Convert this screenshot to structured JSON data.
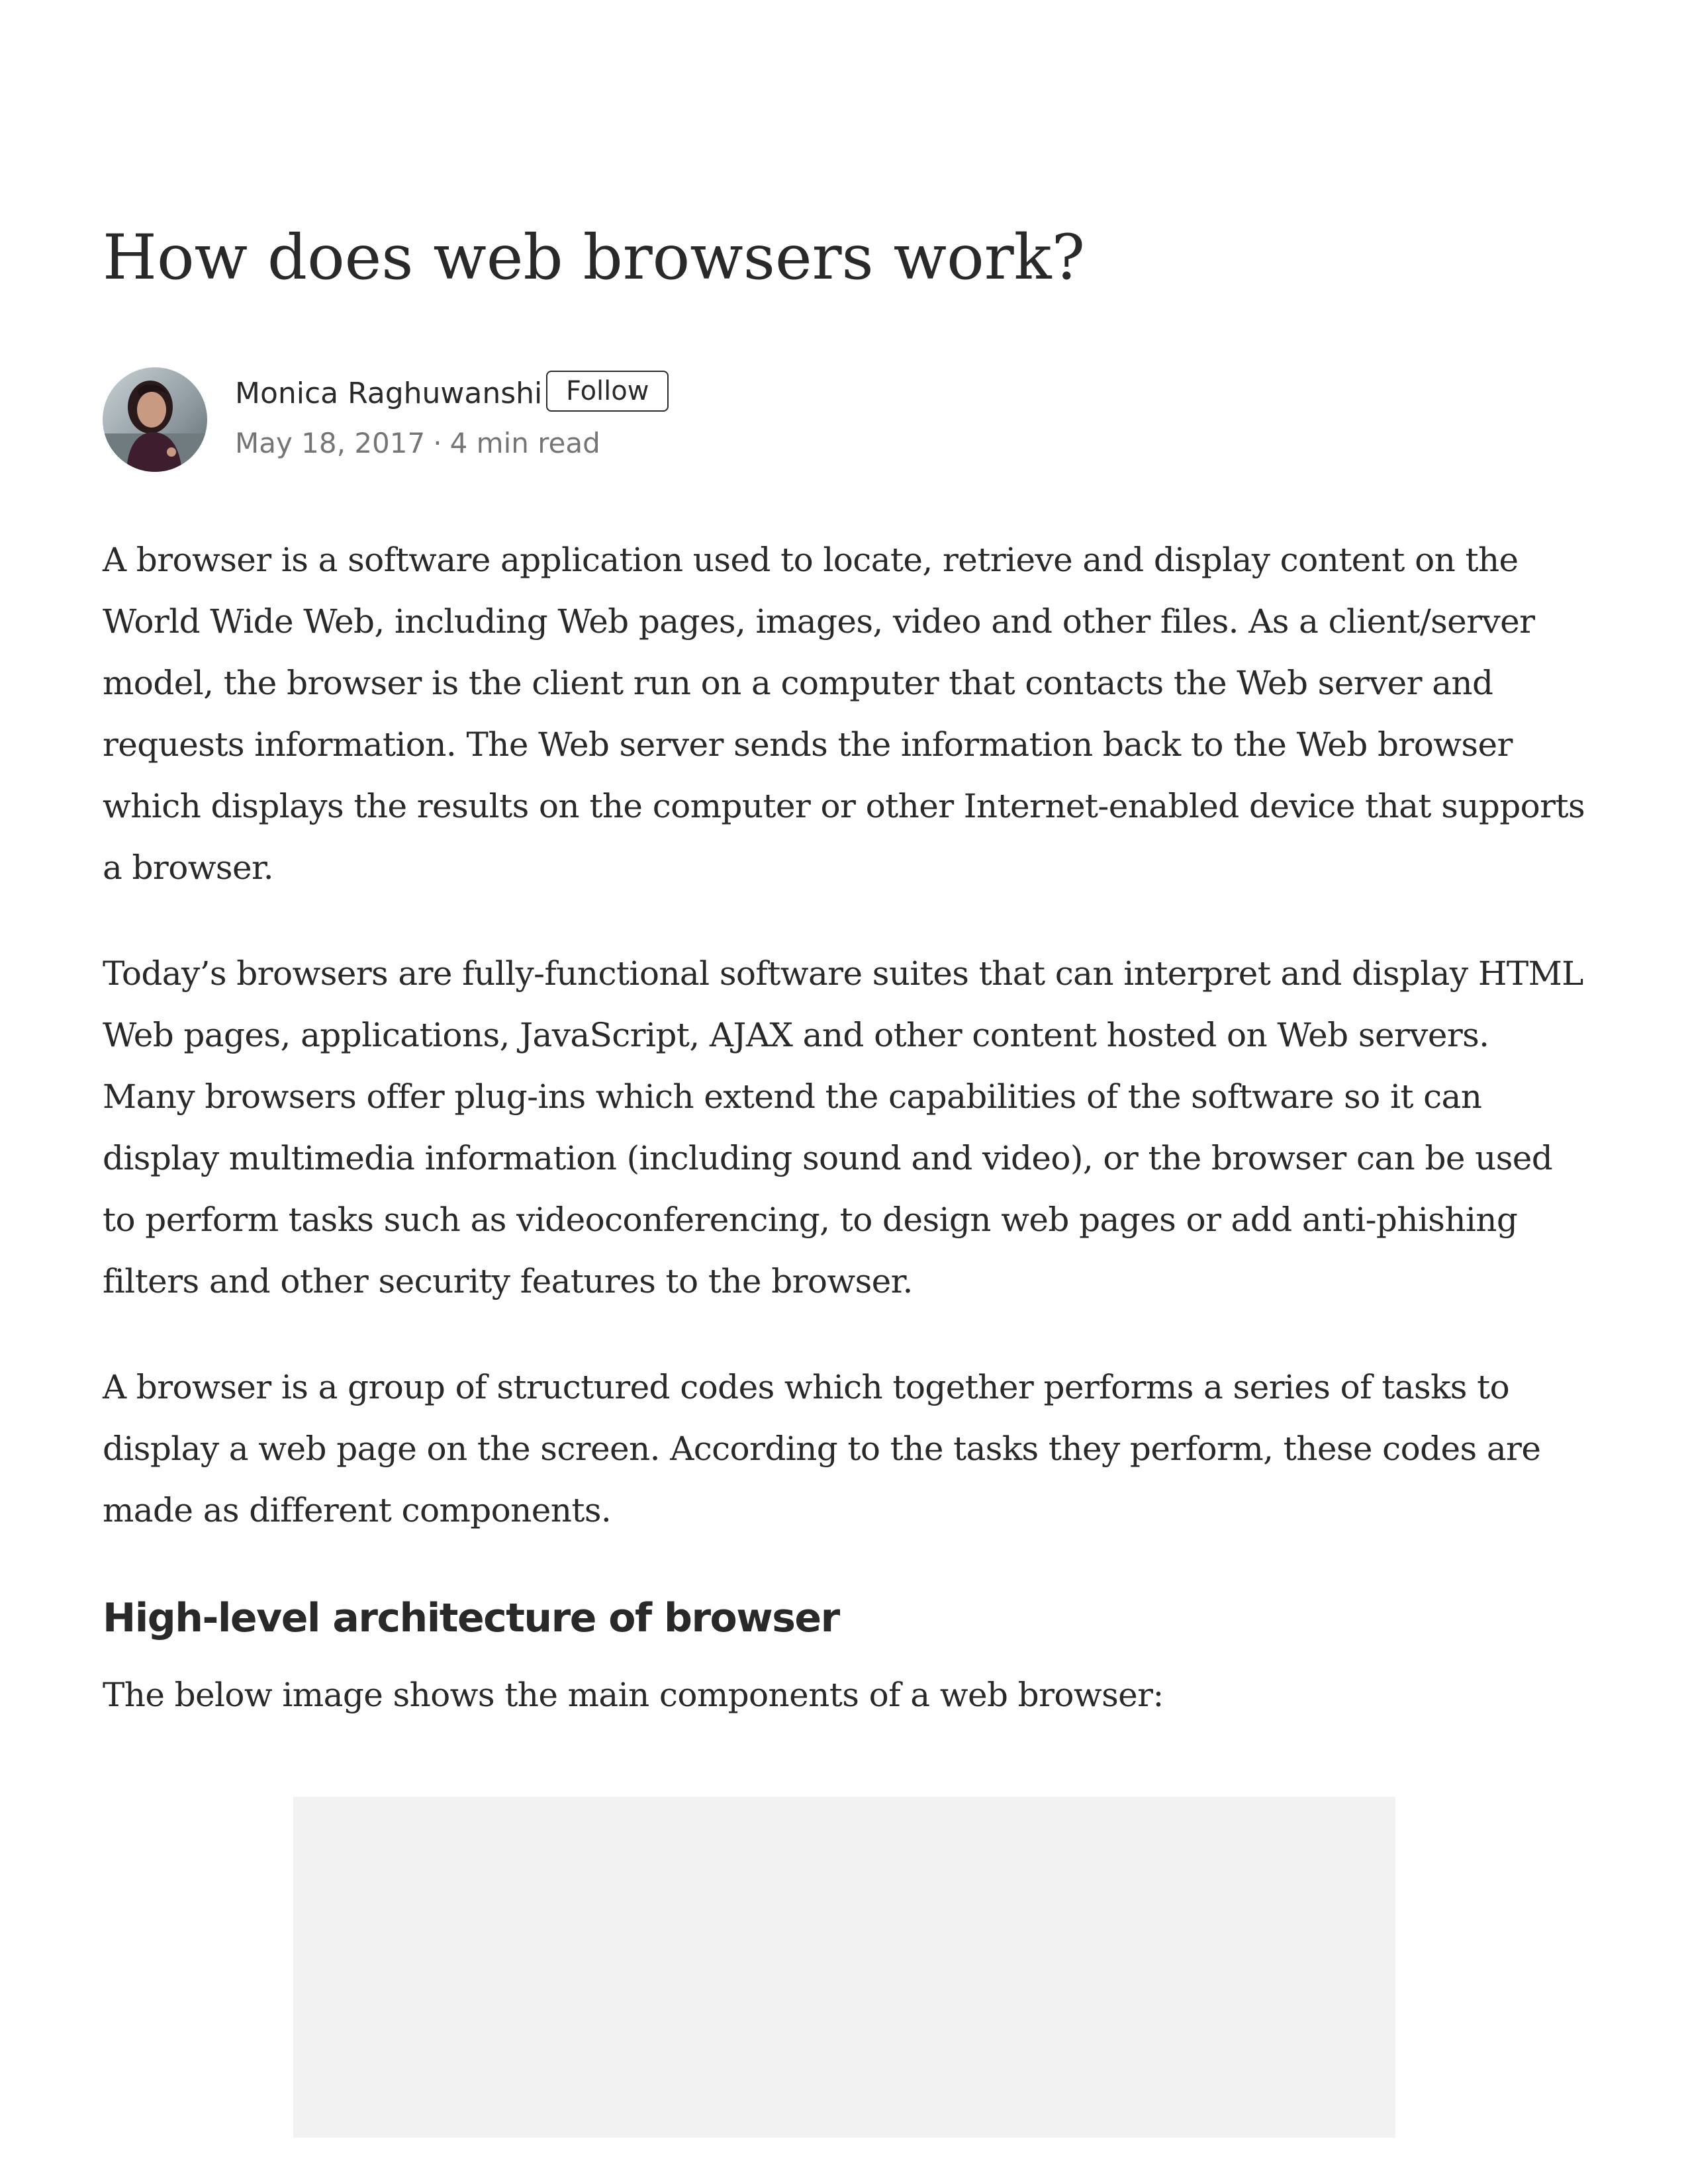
{
  "article": {
    "title": "How does web browsers work?",
    "author": {
      "name": "Monica Raghuwanshi",
      "follow_label": "Follow",
      "date": "May 18, 2017",
      "separator": "·",
      "read_time": "4 min read"
    },
    "paragraphs": [
      "A browser is a software application used to locate, retrieve and display content on the World Wide Web, including Web pages, images, video and other files. As a client/server model, the browser is the client run on a computer that contacts the Web server and requests information. The Web server sends the information back to the Web browser which displays the results on the computer or other Internet-enabled device that supports a browser.",
      "Today’s browsers are fully-functional software suites that can interpret and display HTML Web pages, applications, JavaScript, AJAX and other content hosted on Web servers. Many browsers offer plug-ins which extend the capabilities of the software so it can display multimedia information (including sound and video), or the browser can be used to perform tasks such as videoconferencing, to design web pages or add anti-phishing filters and other security features to the browser.",
      "A browser is a group of structured codes which together performs a series of tasks to display a web page on the screen. According to the tasks they perform, these codes are made as different components."
    ],
    "section": {
      "heading": "High-level architecture of browser",
      "intro": "The below image shows the main components of a web browser:"
    }
  },
  "colors": {
    "text": "#292929",
    "meta": "#757575",
    "image_placeholder": "#f2f2f2"
  }
}
